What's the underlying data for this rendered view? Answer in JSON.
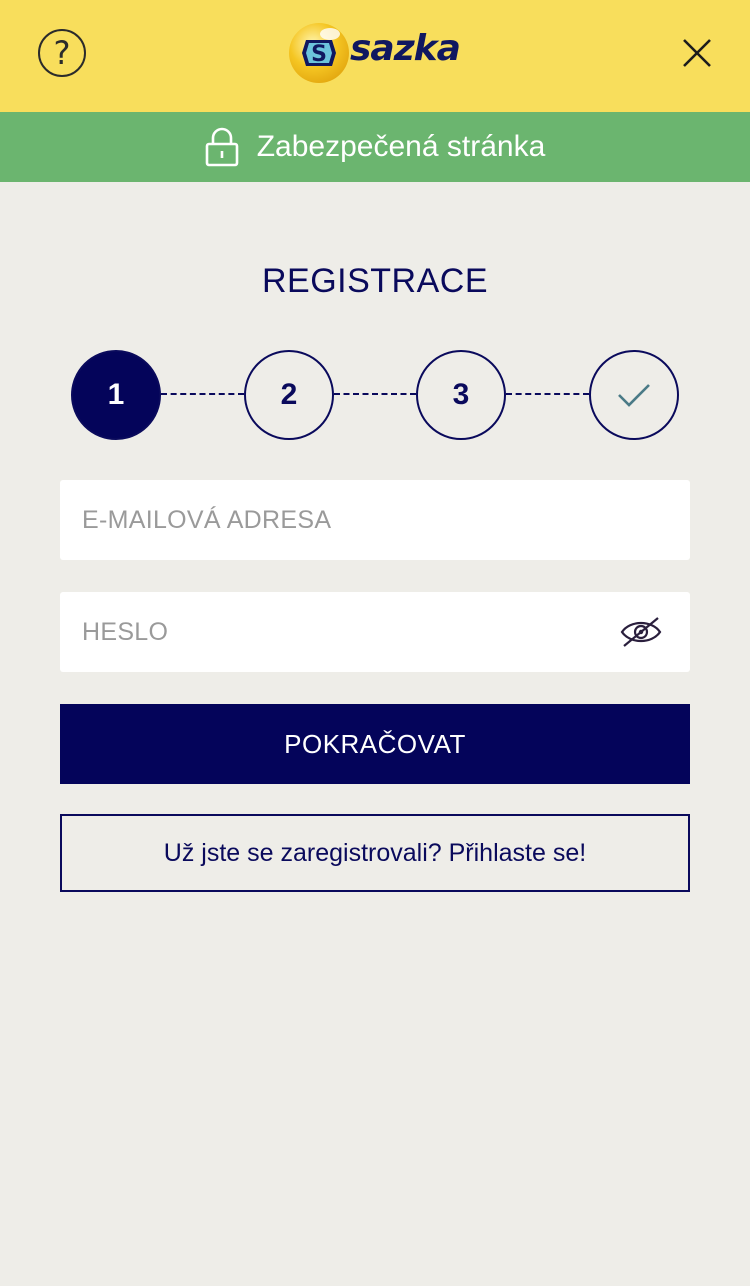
{
  "header": {
    "help_icon": "question-circle-icon",
    "help_glyph": "?",
    "logo_text": "sazka",
    "close_icon": "close-icon"
  },
  "secure_bar": {
    "icon": "lock-icon",
    "text": "Zabezpečená stránka"
  },
  "page": {
    "title": "REGISTRACE"
  },
  "stepper": {
    "steps": [
      {
        "label": "1",
        "state": "active"
      },
      {
        "label": "2",
        "state": "inactive"
      },
      {
        "label": "3",
        "state": "inactive"
      },
      {
        "label": "",
        "icon": "check-icon",
        "state": "inactive"
      }
    ]
  },
  "form": {
    "email": {
      "placeholder": "E-MAILOVÁ ADRESA",
      "value": ""
    },
    "password": {
      "placeholder": "HESLO",
      "value": "",
      "toggle_icon": "eye-off-icon"
    },
    "continue_label": "POKRAČOVAT",
    "login_label": "Už jste se zaregistrovali? Přihlaste se!"
  },
  "colors": {
    "header_bg": "#F8DE5C",
    "secure_bg": "#6BB56F",
    "page_bg": "#EEEDE8",
    "primary": "#04045A"
  }
}
